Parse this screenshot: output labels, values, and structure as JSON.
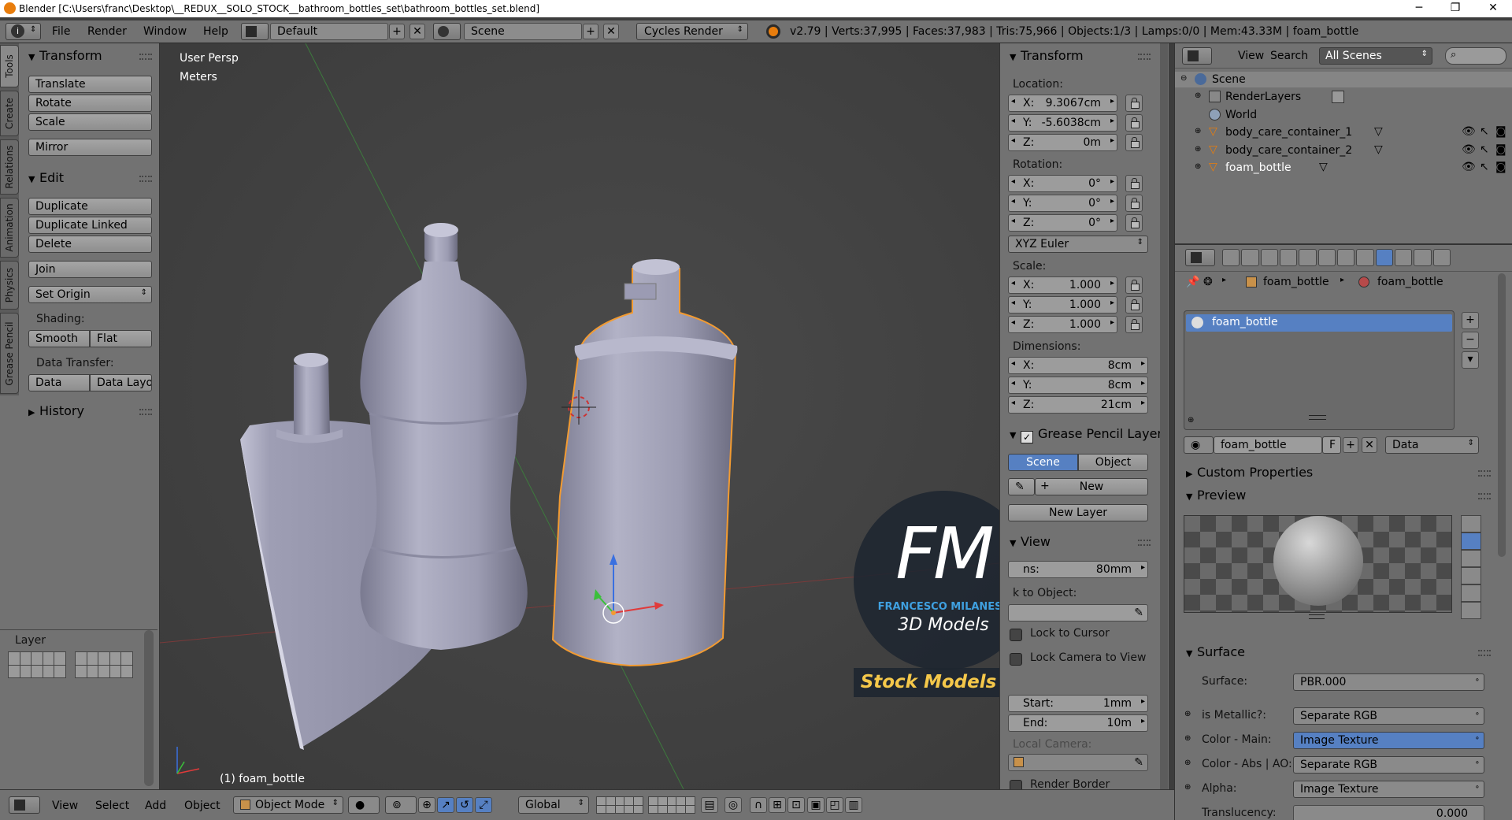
{
  "titlebar": {
    "title": "Blender [C:\\Users\\franc\\Desktop\\__REDUX__SOLO_STOCK__bathroom_bottles_set\\bathroom_bottles_set.blend]"
  },
  "menu": {
    "file": "File",
    "render": "Render",
    "window": "Window",
    "help": "Help"
  },
  "header": {
    "screen_layout": "Default",
    "scene": "Scene",
    "render_engine": "Cycles Render",
    "stats": "v2.79 | Verts:37,995 | Faces:37,983 | Tris:75,966 | Objects:1/3 | Lamps:0/0 | Mem:43.33M | foam_bottle"
  },
  "tabs": {
    "tools": "Tools",
    "create": "Create",
    "relations": "Relations",
    "animation": "Animation",
    "physics": "Physics",
    "grease_pencil": "Grease Pencil"
  },
  "tool_panel": {
    "transform_header": "Transform",
    "translate": "Translate",
    "rotate": "Rotate",
    "scale": "Scale",
    "mirror": "Mirror",
    "edit_header": "Edit",
    "duplicate": "Duplicate",
    "duplicate_linked": "Duplicate Linked",
    "delete": "Delete",
    "join": "Join",
    "set_origin": "Set Origin",
    "shading_label": "Shading:",
    "smooth": "Smooth",
    "flat": "Flat",
    "data_transfer_label": "Data Transfer:",
    "data": "Data",
    "data_layo": "Data Layo",
    "history_header": "History",
    "layer_label": "Layer"
  },
  "viewport": {
    "view_name": "User Persp",
    "units": "Meters",
    "active_object": "(1) foam_bottle",
    "watermark": {
      "fm": "FM",
      "author": "FRANCESCO MILANESE",
      "sub": "3D Models",
      "banner": "Stock Models"
    }
  },
  "n_panel": {
    "transform_header": "Transform",
    "location_label": "Location:",
    "loc_x_axis": "X:",
    "loc_x": "9.3067cm",
    "loc_y_axis": "Y:",
    "loc_y": "-5.6038cm",
    "loc_z_axis": "Z:",
    "loc_z": "0m",
    "rotation_label": "Rotation:",
    "rot_x_axis": "X:",
    "rot_x": "0°",
    "rot_y_axis": "Y:",
    "rot_y": "0°",
    "rot_z_axis": "Z:",
    "rot_z": "0°",
    "rotation_mode": "XYZ Euler",
    "scale_label": "Scale:",
    "scl_x_axis": "X:",
    "scl_x": "1.000",
    "scl_y_axis": "Y:",
    "scl_y": "1.000",
    "scl_z_axis": "Z:",
    "scl_z": "1.000",
    "dimensions_label": "Dimensions:",
    "dim_x_axis": "X:",
    "dim_x": "8cm",
    "dim_y_axis": "Y:",
    "dim_y": "8cm",
    "dim_z_axis": "Z:",
    "dim_z": "21cm",
    "grease_pencil_header": "Grease Pencil Layer",
    "gp_scene": "Scene",
    "gp_object": "Object",
    "gp_new": "New",
    "gp_new_layer": "New Layer",
    "view_header": "View",
    "lens_label": "ns:",
    "lens_value": "80mm",
    "lock_object_label": "k to Object:",
    "lock_to_cursor": "Lock to Cursor",
    "lock_camera": "Lock Camera to View",
    "clip_start_label": "Start:",
    "clip_start": "1mm",
    "clip_end_label": "End:",
    "clip_end": "10m",
    "local_camera": "Local Camera:",
    "render_border": "Render Border"
  },
  "outliner": {
    "view": "View",
    "search": "Search",
    "filter": "All Scenes",
    "items": [
      "Scene",
      "RenderLayers",
      "World",
      "body_care_container_1",
      "body_care_container_2",
      "foam_bottle"
    ]
  },
  "properties": {
    "breadcrumb_object": "foam_bottle",
    "breadcrumb_material": "foam_bottle",
    "material_slot": "foam_bottle",
    "material_name": "foam_bottle",
    "fake_user": "F",
    "link_mode": "Data",
    "custom_props": "Custom Properties",
    "preview": "Preview",
    "surface_header": "Surface",
    "surface_label": "Surface:",
    "surface_value": "PBR.000",
    "rows": [
      {
        "label": "is Metallic?:",
        "value": "Separate RGB"
      },
      {
        "label": "Color - Main:",
        "value": "Image Texture"
      },
      {
        "label": "Color - Abs | AO:",
        "value": "Separate RGB"
      },
      {
        "label": "Alpha:",
        "value": "Image Texture"
      }
    ],
    "translucency_label": "Translucency:",
    "translucency_value": "0.000"
  },
  "bottom_header": {
    "view": "View",
    "select": "Select",
    "add": "Add",
    "object": "Object",
    "mode": "Object Mode",
    "orientation": "Global"
  },
  "colors": {
    "accent_blue": "#5680c2",
    "selection_orange": "#f29b32",
    "panel_grey": "#727272",
    "viewport_grey": "#3d3d3d",
    "watermark_yellow": "#f5c84a",
    "watermark_blue": "#3fa0e0"
  }
}
